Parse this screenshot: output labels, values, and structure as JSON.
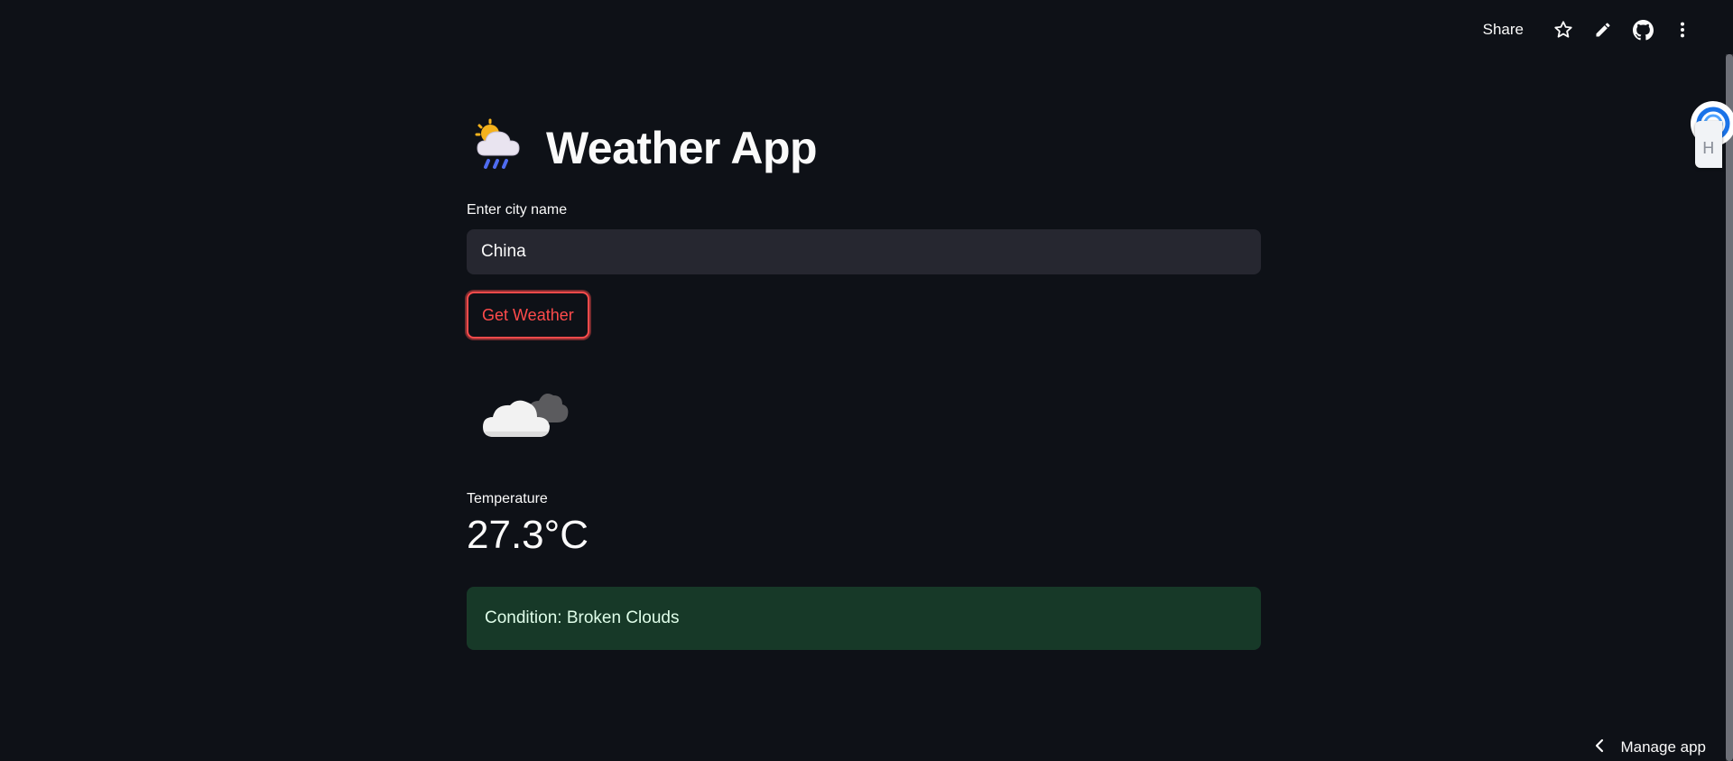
{
  "header": {
    "share_label": "Share",
    "icons": [
      "star-icon",
      "pencil-icon",
      "github-icon",
      "more-vertical-icon"
    ]
  },
  "app": {
    "title": "Weather App",
    "title_emoji": "cloud-sun-rain-icon"
  },
  "city_input": {
    "label": "Enter city name",
    "value": "China"
  },
  "get_weather_button": {
    "label": "Get Weather"
  },
  "weather_icon": "broken-clouds-icon",
  "temperature": {
    "label": "Temperature",
    "value": "27.3°C"
  },
  "condition": {
    "text": "Condition: Broken Clouds"
  },
  "footer": {
    "manage_label": "Manage app"
  },
  "colors": {
    "background": "#0e1117",
    "accent": "#ff4b4b",
    "input_bg": "#262730",
    "success_bg": "#173928",
    "success_text": "#dffde9"
  }
}
